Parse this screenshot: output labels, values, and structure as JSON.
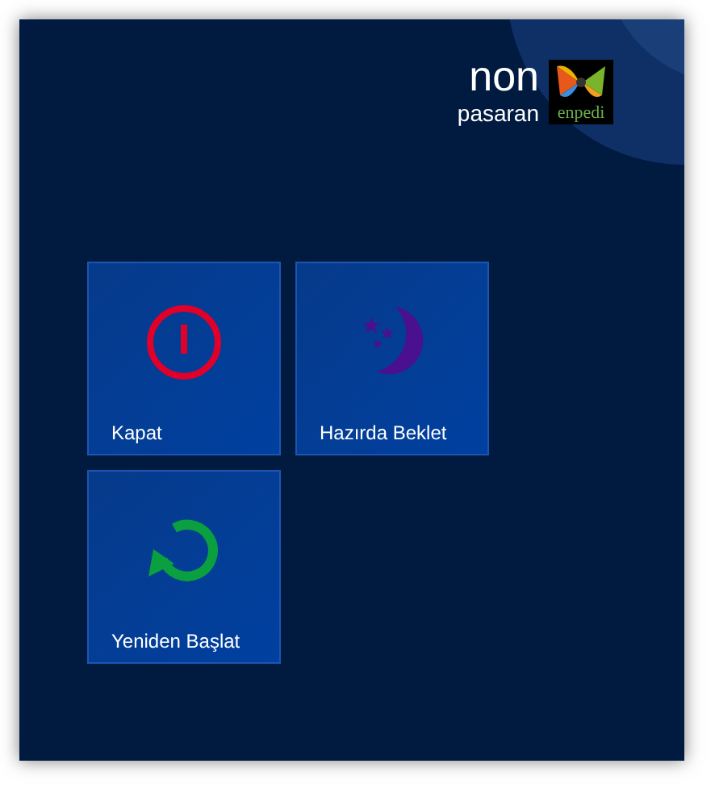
{
  "user": {
    "first_name": "non",
    "last_name": "pasaran",
    "logo_text": "enpedi"
  },
  "tiles": [
    {
      "kind": "shutdown",
      "label": "Kapat"
    },
    {
      "kind": "sleep",
      "label": "Hazırda Beklet"
    },
    {
      "kind": "restart",
      "label": "Yeniden Başlat"
    }
  ]
}
